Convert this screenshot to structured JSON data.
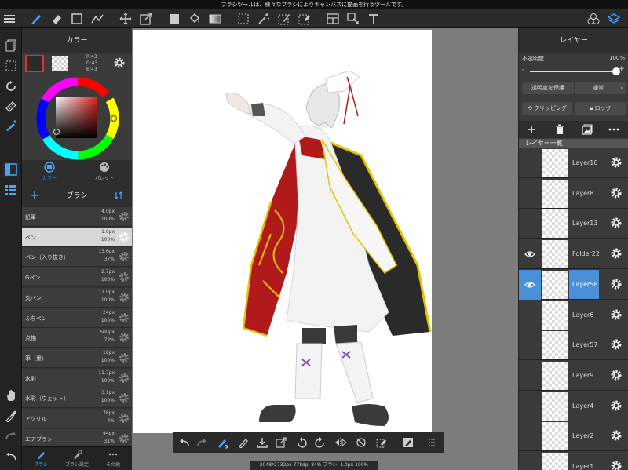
{
  "hint": "ブラシツールは、様々なブラシによりキャンバスに描画を行うツールです。",
  "color": {
    "title": "カラー",
    "r": "R:43",
    "g": "G:43",
    "b": "B:43",
    "tab_color": "カラー",
    "tab_palette": "パレット",
    "primary": "#2b2b2b"
  },
  "brush": {
    "title": "ブラシ",
    "items": [
      {
        "name": "鉛筆",
        "size": "4.0px",
        "opacity": "100%"
      },
      {
        "name": "ペン",
        "size": "1.0px",
        "opacity": "100%"
      },
      {
        "name": "ペン（入り抜き）",
        "size": "13.6px",
        "opacity": "37%"
      },
      {
        "name": "Gペン",
        "size": "2.7px",
        "opacity": "100%"
      },
      {
        "name": "丸ペン",
        "size": "11.0px",
        "opacity": "100%"
      },
      {
        "name": "ふちペン",
        "size": "24px",
        "opacity": "100%"
      },
      {
        "name": "点描",
        "size": "500px",
        "opacity": "72%"
      },
      {
        "name": "筆（墨）",
        "size": "18px",
        "opacity": "100%"
      },
      {
        "name": "水彩",
        "size": "11.7px",
        "opacity": "100%"
      },
      {
        "name": "水彩（ウェット）",
        "size": "3.1px",
        "opacity": "100%"
      },
      {
        "name": "アクリル",
        "size": "76px",
        "opacity": "4%"
      },
      {
        "name": "エアブラシ",
        "size": "94px",
        "opacity": "31%"
      }
    ],
    "tab_brush": "ブラシ",
    "tab_settings": "ブラシ設定",
    "tab_other": "その他"
  },
  "layers": {
    "title": "レイヤー",
    "opacity_label": "不透明度",
    "opacity_value": "100%",
    "opacity_fraction": 1.0,
    "protect_alpha": "透明度を保護",
    "blend_mode": "通常",
    "clipping": "クリッピング",
    "lock": "ロック",
    "list_title": "レイヤー一覧",
    "items": [
      {
        "name": "Layer10",
        "visible": false,
        "selected": false
      },
      {
        "name": "Layer8",
        "visible": false,
        "selected": false
      },
      {
        "name": "Layer13",
        "visible": false,
        "selected": false
      },
      {
        "name": "Folder22",
        "visible": true,
        "selected": false
      },
      {
        "name": "Layer58",
        "visible": true,
        "selected": true
      },
      {
        "name": "Layer6",
        "visible": false,
        "selected": false
      },
      {
        "name": "Layer57",
        "visible": false,
        "selected": false
      },
      {
        "name": "Layer9",
        "visible": false,
        "selected": false
      },
      {
        "name": "Layer4",
        "visible": false,
        "selected": false
      },
      {
        "name": "Layer2",
        "visible": false,
        "selected": false
      },
      {
        "name": "Layer1",
        "visible": false,
        "selected": false
      }
    ]
  },
  "status": "2048*2732px 778dpi 84% ブラシ: 1.0px 100%",
  "accent": "#4a90d9"
}
